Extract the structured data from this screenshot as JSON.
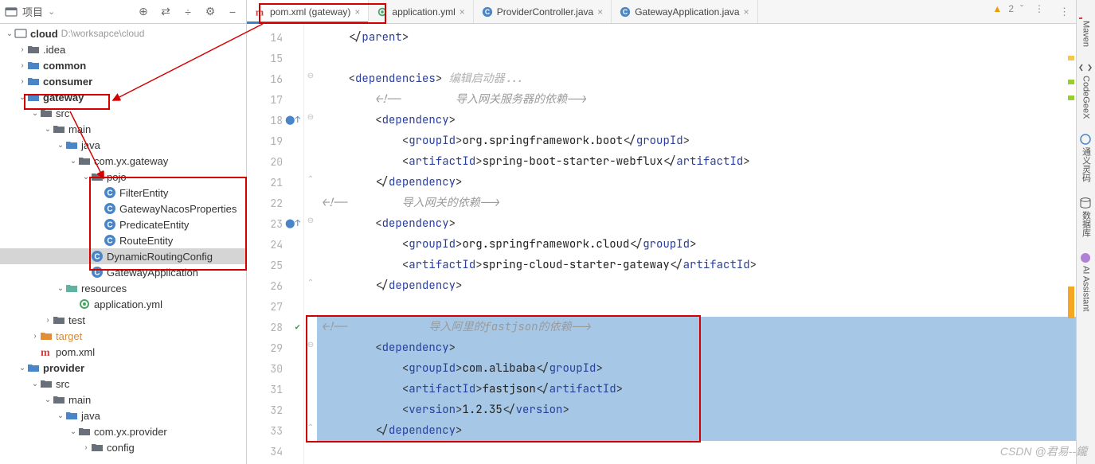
{
  "leftPanel": {
    "title": "项目",
    "toolbar": [
      "⊕",
      "⇄",
      "÷",
      "⚙",
      "−"
    ]
  },
  "tree": {
    "root": {
      "label": "cloud",
      "path": "D:\\worksapce\\cloud"
    },
    "idea": ".idea",
    "common": "common",
    "consumer": "consumer",
    "gateway": "gateway",
    "src": "src",
    "main": "main",
    "java": "java",
    "pkg_gateway": "com.yx.gateway",
    "pojo": "pojo",
    "filterEntity": "FilterEntity",
    "gatewayNacosProperties": "GatewayNacosProperties",
    "predicateEntity": "PredicateEntity",
    "routeEntity": "RouteEntity",
    "dynamicRoutingConfig": "DynamicRoutingConfig",
    "gatewayApplication": "GatewayApplication",
    "resources": "resources",
    "appyml": "application.yml",
    "test": "test",
    "target": "target",
    "pom": "pom.xml",
    "provider": "provider",
    "src2": "src",
    "main2": "main",
    "java2": "java",
    "pkg_provider": "com.yx.provider",
    "config": "config"
  },
  "tabs": {
    "t1": "pom.xml (gateway)",
    "t2": "application.yml",
    "t3": "ProviderController.java",
    "t4": "GatewayApplication.java"
  },
  "status": {
    "warnCount": "2"
  },
  "code": {
    "l14": [
      "</",
      "parent",
      ">"
    ],
    "l16_open": [
      "<",
      "dependencies",
      ">"
    ],
    "l16_hint": " 编辑启动器...",
    "l17": "<!--        导入网关服务器的依赖-->",
    "l18": [
      "<",
      "dependency",
      ">"
    ],
    "l19_open": [
      "<",
      "groupId",
      ">"
    ],
    "l19_txt": "org.springframework.boot",
    "l19_close": [
      "</",
      "groupId",
      ">"
    ],
    "l20_open": [
      "<",
      "artifactId",
      ">"
    ],
    "l20_txt": "spring-boot-starter-webflux",
    "l20_close": [
      "</",
      "artifactId",
      ">"
    ],
    "l21": [
      "</",
      "dependency",
      ">"
    ],
    "l22": "<!--        导入网关的依赖-->",
    "l23": [
      "<",
      "dependency",
      ">"
    ],
    "l24_open": [
      "<",
      "groupId",
      ">"
    ],
    "l24_txt": "org.springframework.cloud",
    "l24_close": [
      "</",
      "groupId",
      ">"
    ],
    "l25_open": [
      "<",
      "artifactId",
      ">"
    ],
    "l25_txt": "spring-cloud-starter-gateway",
    "l25_close": [
      "</",
      "artifactId",
      ">"
    ],
    "l26": [
      "</",
      "dependency",
      ">"
    ],
    "l28_a": "<!--            导入阿里的",
    "l28_b": "fastjson",
    "l28_c": "的依赖-->",
    "l29": [
      "<",
      "dependency",
      ">"
    ],
    "l30_open": [
      "<",
      "groupId",
      ">"
    ],
    "l30_txt": "com.alibaba",
    "l30_close": [
      "</",
      "groupId",
      ">"
    ],
    "l31_open": [
      "<",
      "artifactId",
      ">"
    ],
    "l31_txt": "fastjson",
    "l31_close": [
      "</",
      "artifactId",
      ">"
    ],
    "l32_open": [
      "<",
      "version",
      ">"
    ],
    "l32_txt": "1.2.35",
    "l32_close": [
      "</",
      "version",
      ">"
    ],
    "l33": [
      "</",
      "dependency",
      ">"
    ]
  },
  "gutter": [
    "14",
    "15",
    "16",
    "17",
    "18",
    "19",
    "20",
    "21",
    "22",
    "23",
    "24",
    "25",
    "26",
    "27",
    "28",
    "29",
    "30",
    "31",
    "32",
    "33",
    "34"
  ],
  "rightTools": {
    "maven": "Maven",
    "codegeex": "CodeGeeX",
    "tongyi": "通义灵码",
    "db": "数据库",
    "ai": "AI Assistant"
  },
  "watermark": "CSDN @君易--鑨"
}
